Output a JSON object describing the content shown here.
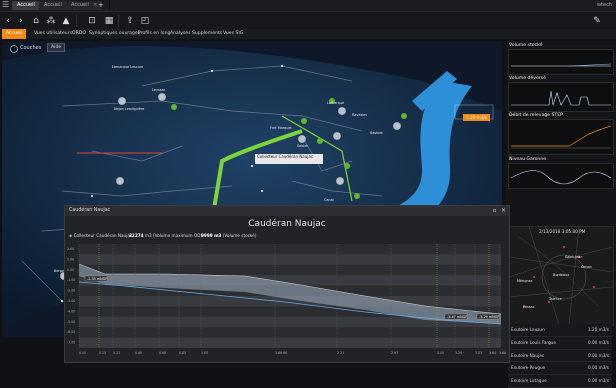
{
  "titlebar": {
    "tabs": [
      "Accueil",
      "Accueil",
      "Accueil"
    ],
    "user": "wtech"
  },
  "navbar": {
    "items": [
      "Accueil",
      "Vues utilisateurs",
      "ORDO",
      "Synoptiques ouvrages",
      "Profils en long",
      "Analyses",
      "Supplements",
      "Vues SIG"
    ]
  },
  "map": {
    "layer_label": "Couches",
    "layer_button": "Aide",
    "tooltip_title": "Collecteur Caudéran Naujac",
    "rate_badge": "1.20 m3/s",
    "labels": [
      "Lamarque Lescure",
      "Leyssac",
      "Nejon Lesdiguière",
      "Lamarque",
      "Fort Marquet",
      "Sablet",
      "Ravezies",
      "Bastide",
      "Canal",
      "Caudéran",
      "Berges",
      "Bègles"
    ]
  },
  "right_panel": {
    "titles": [
      "Volume stocké",
      "Volume déversé",
      "Débit de relevage STEP",
      "Niveau Garonne"
    ],
    "weather_time": "2/13/2018 3:05:00 PM",
    "weather_places": [
      "Bordeaux",
      "Talence",
      "Cenon",
      "Mérignac",
      "Pessac",
      "Saint-Jean"
    ],
    "stations": [
      {
        "name": "Exutoire Lauzun",
        "value": "1.20 m3/s"
      },
      {
        "name": "Exutoire Louis Fargue",
        "value": "0.00 m3/s"
      },
      {
        "name": "Exutoire Naujac",
        "value": "0.00 m3/s"
      },
      {
        "name": "Exutoire Peugue",
        "value": "0.00 m3/s"
      },
      {
        "name": "Exutoire Lataque",
        "value": "0.00 m3/s"
      }
    ]
  },
  "popup": {
    "small_title": "Caudéran Naujac",
    "big_title": "Caudéran Naujac",
    "info": {
      "label": "Collecteur Caudéran Naujac",
      "value1": "32274",
      "desc1": "m3 (Volume maximum OD)",
      "value2": "9999 m3",
      "desc2": "(Volume stocké)"
    },
    "y_ticks": [
      "2.00",
      "1.00",
      "0.00",
      "-1.00",
      "-2.00",
      "-3.00",
      "-4.00",
      "-5.00",
      "-6.00",
      "-7.00"
    ],
    "x_ticks": [
      "0.00",
      "0.15",
      "0.21",
      "0.40",
      "0.66",
      "0.85",
      "1.00",
      "1.66 66",
      "2.21",
      "2.97",
      "3.00",
      "3.24",
      "3.53",
      "3.64",
      "3.66"
    ],
    "badges": [
      "-2.35 mNGF",
      "-3.47 mNGF",
      "-3.29 mNGF"
    ]
  }
}
